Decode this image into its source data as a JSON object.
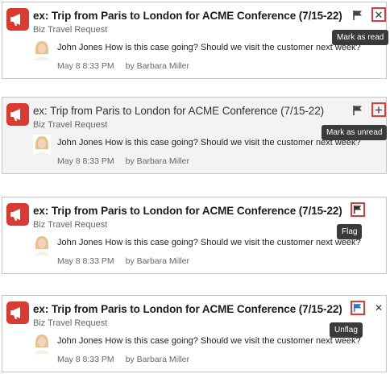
{
  "notifications": [
    {
      "title": "ex: Trip from Paris to London for ACME Conference (7/15-22)",
      "subtitle": "Biz Travel Request",
      "message": "John Jones How is this case going? Should we visit the customer next week?",
      "timestamp": "May 8 8:33 PM",
      "author": "by Barbara Miller",
      "read": false,
      "flagged": false,
      "action_icon": "close-icon",
      "action_glyph": "✕",
      "tooltip": "Mark as read",
      "highlighted": "action"
    },
    {
      "title": "ex: Trip from Paris to London for ACME Conference (7/15-22)",
      "subtitle": "Biz Travel Request",
      "message": "John Jones How is this case going? Should we visit the customer next week?",
      "timestamp": "May 8 8:33 PM",
      "author": "by Barbara Miller",
      "read": true,
      "flagged": false,
      "action_icon": "plus-icon",
      "action_glyph": "+",
      "tooltip": "Mark as unread",
      "highlighted": "action"
    },
    {
      "title": "ex: Trip from Paris to London for ACME Conference (7/15-22)",
      "subtitle": "Biz Travel Request",
      "message": "John Jones How is this case going? Should we visit the customer next week?",
      "timestamp": "May 8 8:33 PM",
      "author": "by Barbara Miller",
      "read": false,
      "flagged": false,
      "action_icon": null,
      "action_glyph": "",
      "tooltip": "Flag",
      "highlighted": "flag"
    },
    {
      "title": "ex: Trip from Paris to London for ACME Conference (7/15-22)",
      "subtitle": "Biz Travel Request",
      "message": "John Jones How is this case going? Should we visit the customer next week?",
      "timestamp": "May 8 8:33 PM",
      "author": "by Barbara Miller",
      "read": false,
      "flagged": true,
      "action_icon": "close-icon",
      "action_glyph": "✕",
      "tooltip": "Unflag",
      "highlighted": "flag"
    }
  ],
  "colors": {
    "app_icon": "#d93a31",
    "highlight": "#e23a3a",
    "flag_default": "#444444",
    "flag_active": "#1f7bd8",
    "tooltip_bg": "#3a3a3a"
  }
}
